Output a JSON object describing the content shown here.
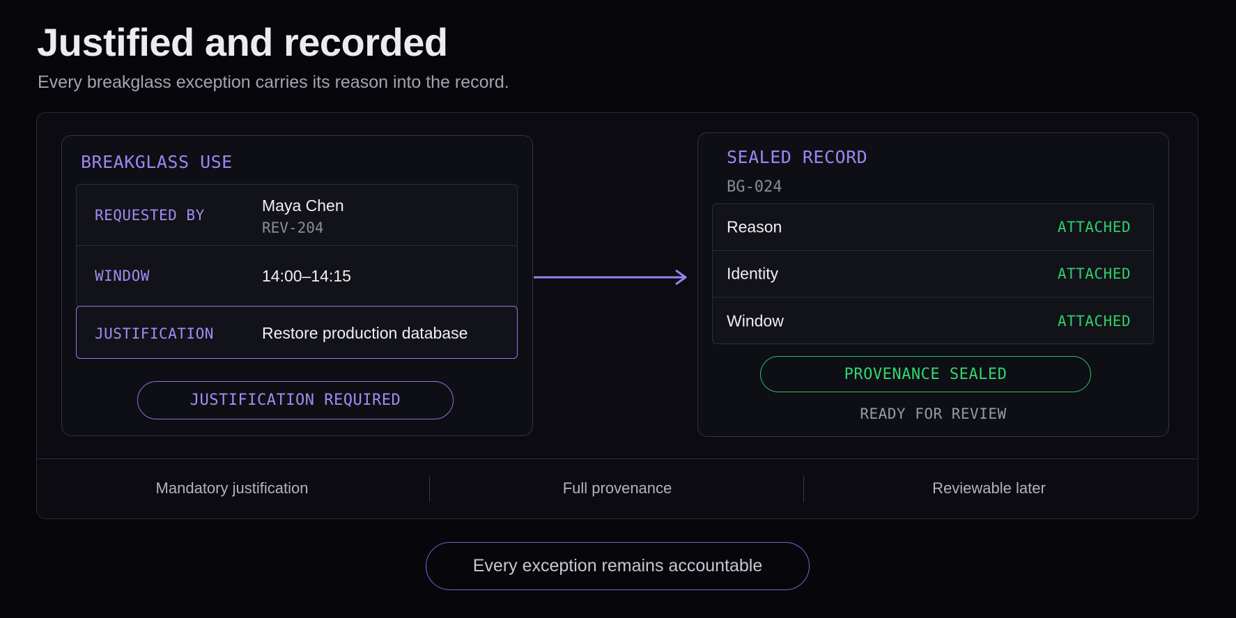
{
  "header": {
    "title": "Justified and recorded",
    "subtitle": "Every breakglass exception carries its reason into the record."
  },
  "breakglass": {
    "heading": "BREAKGLASS USE",
    "fields": [
      {
        "label": "REQUESTED BY",
        "value": "Maya Chen",
        "sub": "REV-204"
      },
      {
        "label": "WINDOW",
        "value": "14:00–14:15"
      }
    ],
    "justification": {
      "label": "JUSTIFICATION",
      "value": "Restore production database"
    },
    "required_badge": "JUSTIFICATION REQUIRED"
  },
  "record": {
    "heading": "SEALED RECORD",
    "id": "BG-024",
    "rows": [
      {
        "name": "Reason",
        "status": "ATTACHED"
      },
      {
        "name": "Identity",
        "status": "ATTACHED"
      },
      {
        "name": "Window",
        "status": "ATTACHED"
      }
    ],
    "sealed_badge": "PROVENANCE SEALED",
    "state": "READY FOR REVIEW"
  },
  "features": [
    "Mandatory justification",
    "Full provenance",
    "Reviewable later"
  ],
  "footer": {
    "tagline": "Every exception remains accountable"
  },
  "colors": {
    "accent_purple": "#9f86f2",
    "accent_green": "#2ed06a",
    "background": "#07070b"
  },
  "icons": {
    "flow": "arrow-right-icon"
  }
}
